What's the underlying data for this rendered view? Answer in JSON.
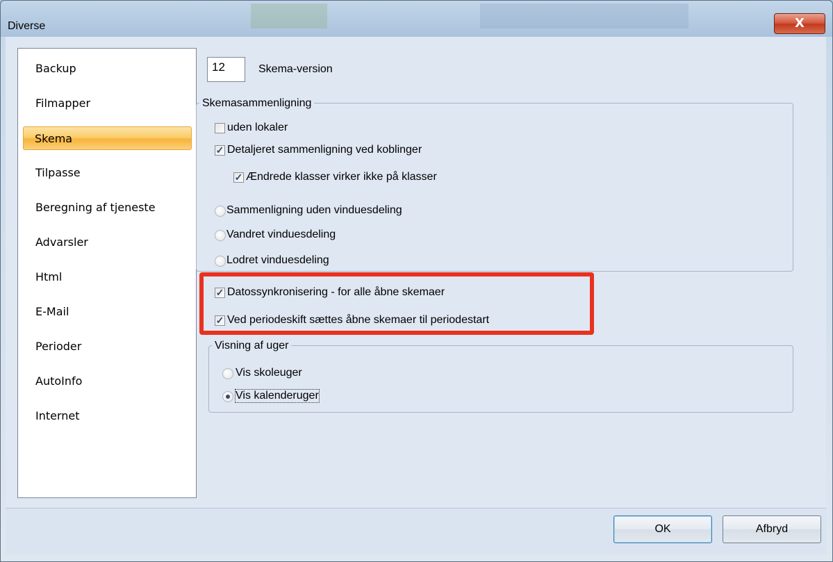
{
  "window": {
    "title": "Diverse",
    "close_glyph": "X"
  },
  "sidebar": {
    "items": [
      {
        "label": "Backup"
      },
      {
        "label": "Filmapper"
      },
      {
        "label": "Skema",
        "selected": true
      },
      {
        "label": "Tilpasse"
      },
      {
        "label": "Beregning af tjeneste"
      },
      {
        "label": "Advarsler"
      },
      {
        "label": "Html"
      },
      {
        "label": "E-Mail"
      },
      {
        "label": "Perioder"
      },
      {
        "label": "AutoInfo"
      },
      {
        "label": "Internet"
      }
    ]
  },
  "schema_version": {
    "value": "12",
    "label": "Skema-version"
  },
  "comparison_group": {
    "legend": "Skemasammenligning",
    "without_rooms": {
      "label": "uden lokaler",
      "checked": false
    },
    "detailed": {
      "label": "Detaljeret sammenligning ved koblinger",
      "checked": true
    },
    "changed_classes": {
      "label": "Ændrede klasser virker ikke på klasser",
      "checked": true
    },
    "no_split": {
      "label": "Sammenligning uden vinduesdeling"
    },
    "horizontal_split": {
      "label": "Vandret vinduesdeling"
    },
    "vertical_split": {
      "label": "Lodret vinduesdeling"
    }
  },
  "sync": {
    "date_sync": {
      "label": "Datossynkronisering - for alle åbne skemaer",
      "checked": true
    },
    "period_change": {
      "label": "Ved periodeskift sættes åbne skemaer til periodestart",
      "checked": true
    }
  },
  "weeks_group": {
    "legend": "Visning af uger",
    "school_weeks": {
      "label": "Vis skoleuger",
      "selected": false
    },
    "calendar_weeks": {
      "label": "Vis kalenderuger",
      "selected": true
    }
  },
  "buttons": {
    "ok": "OK",
    "cancel": "Afbryd"
  },
  "colors": {
    "selection": "#f8b43c",
    "highlight_box": "#e8321f",
    "close_button": "#c2391f"
  }
}
